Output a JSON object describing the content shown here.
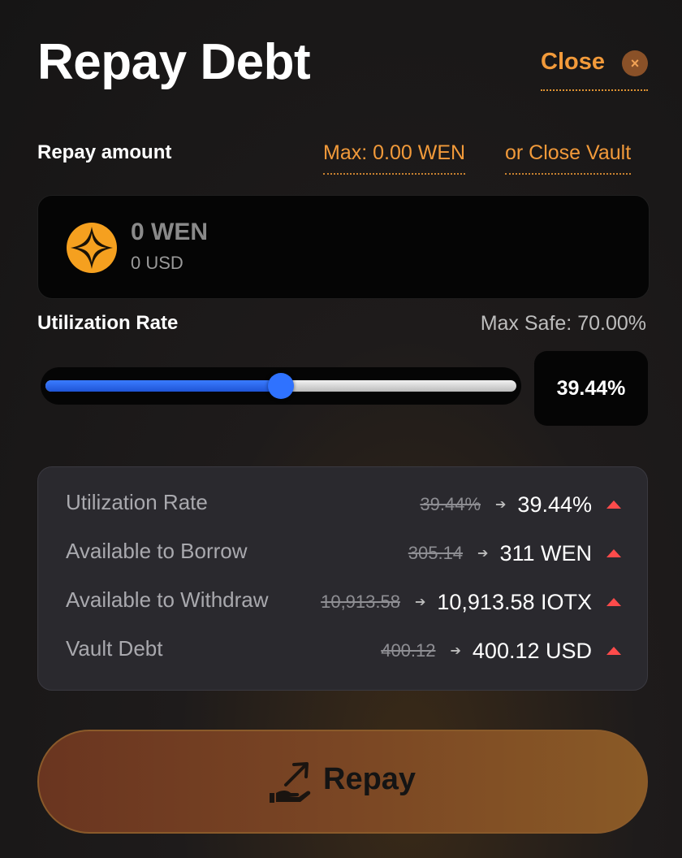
{
  "header": {
    "title": "Repay Debt",
    "close_label": "Close",
    "close_icon": "×"
  },
  "repay": {
    "label": "Repay amount",
    "max_link": "Max: 0.00 WEN",
    "close_vault_link": "or Close Vault",
    "amount_value": "0 WEN",
    "amount_usd": "0 USD",
    "token_icon": "wen-token-icon"
  },
  "utilization": {
    "label": "Utilization Rate",
    "max_safe": "Max Safe: 70.00%",
    "rate_display": "39.44%",
    "slider_fraction": 0.5
  },
  "stats": [
    {
      "label": "Utilization Rate",
      "old": "39.44%",
      "new": "39.44%"
    },
    {
      "label": "Available to Borrow",
      "old": "305.14",
      "new": "311 WEN"
    },
    {
      "label": "Available to Withdraw",
      "old": "10,913.58",
      "new": "10,913.58 IOTX"
    },
    {
      "label": "Vault Debt",
      "old": "400.12",
      "new": "400.12 USD"
    }
  ],
  "colors": {
    "accent": "#f29a3a",
    "slider_blue": "#2f72ff",
    "up_indicator": "#ff4b4b"
  },
  "action": {
    "repay_label": "Repay",
    "repay_icon": "hand-arrow-icon"
  }
}
